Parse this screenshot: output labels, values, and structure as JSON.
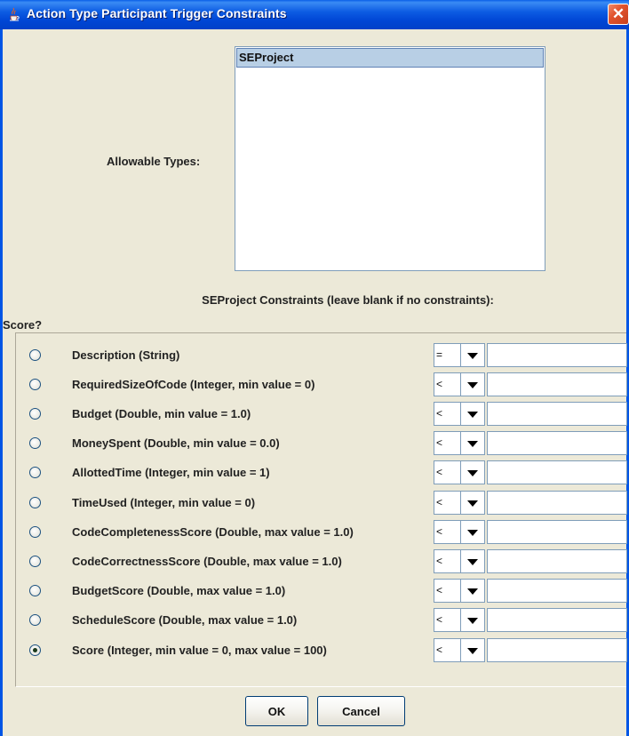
{
  "window": {
    "title": "Action Type Participant Trigger Constraints",
    "close_label": "✕"
  },
  "allowable": {
    "label": "Allowable Types:",
    "items": [
      "SEProject"
    ],
    "selected_index": 0
  },
  "constraints": {
    "heading": "SEProject Constraints  (leave blank if no constraints):",
    "score_column_label": "Score?",
    "rows": [
      {
        "label": "Description (String)",
        "operator": "=",
        "value": "",
        "score_selected": false
      },
      {
        "label": "RequiredSizeOfCode (Integer, min value = 0)",
        "operator": "<",
        "value": "",
        "score_selected": false
      },
      {
        "label": "Budget (Double, min value = 1.0)",
        "operator": "<",
        "value": "",
        "score_selected": false
      },
      {
        "label": "MoneySpent (Double, min value = 0.0)",
        "operator": "<",
        "value": "",
        "score_selected": false
      },
      {
        "label": "AllottedTime (Integer, min value = 1)",
        "operator": "<",
        "value": "",
        "score_selected": false
      },
      {
        "label": "TimeUsed (Integer, min value = 0)",
        "operator": "<",
        "value": "",
        "score_selected": false
      },
      {
        "label": "CodeCompletenessScore (Double, max value = 1.0)",
        "operator": "<",
        "value": "",
        "score_selected": false
      },
      {
        "label": "CodeCorrectnessScore (Double, max value = 1.0)",
        "operator": "<",
        "value": "",
        "score_selected": false
      },
      {
        "label": "BudgetScore (Double, max value = 1.0)",
        "operator": "<",
        "value": "",
        "score_selected": false
      },
      {
        "label": "ScheduleScore (Double, max value = 1.0)",
        "operator": "<",
        "value": "",
        "score_selected": false
      },
      {
        "label": "Score (Integer, min value = 0, max value = 100)",
        "operator": "<",
        "value": "",
        "score_selected": true
      }
    ]
  },
  "buttons": {
    "ok_label": "OK",
    "cancel_label": "Cancel"
  }
}
